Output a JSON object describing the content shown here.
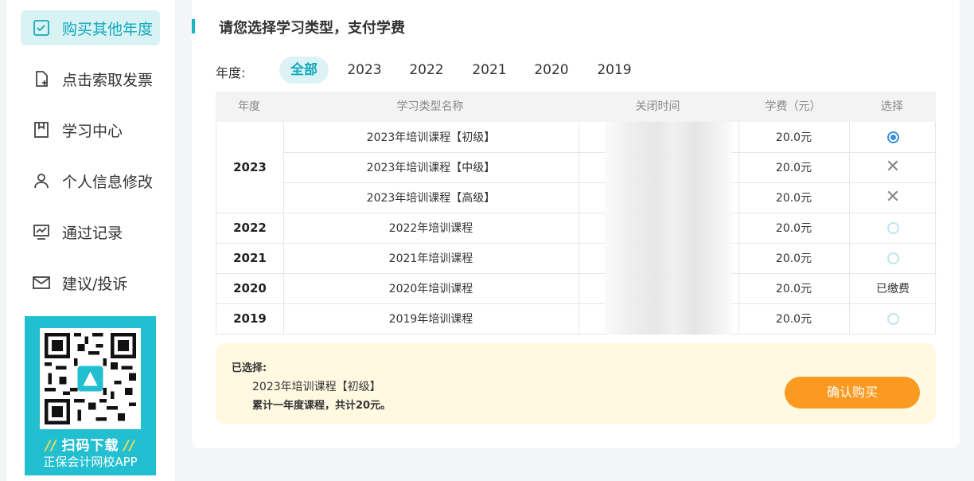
{
  "sidebar": {
    "items": [
      {
        "label": "购买其他年度",
        "icon": "check-square-icon",
        "active": true
      },
      {
        "label": "点击索取发票",
        "icon": "document-add-icon",
        "active": false
      },
      {
        "label": "学习中心",
        "icon": "bookmark-icon",
        "active": false
      },
      {
        "label": "个人信息修改",
        "icon": "user-icon",
        "active": false
      },
      {
        "label": "通过记录",
        "icon": "chart-monitor-icon",
        "active": false
      },
      {
        "label": "建议/投诉",
        "icon": "mail-icon",
        "active": false
      }
    ],
    "qr": {
      "cta": "扫码下载",
      "slash": "//",
      "app_name": "正保会计网校APP"
    }
  },
  "main": {
    "title": "请您选择学习类型，支付学费",
    "year_filter": {
      "label": "年度:",
      "tabs": [
        "全部",
        "2023",
        "2022",
        "2021",
        "2020",
        "2019"
      ],
      "active": "全部"
    },
    "table": {
      "headers": [
        "年度",
        "学习类型名称",
        "关闭时间",
        "学费（元）",
        "选择"
      ],
      "rows": [
        {
          "year": "2023",
          "name": "2023年培训课程【初级】",
          "fee": "20.0元",
          "select": "checked"
        },
        {
          "year": "",
          "name": "2023年培训课程【中级】",
          "fee": "20.0元",
          "select": "unavailable"
        },
        {
          "year": "",
          "name": "2023年培训课程【高级】",
          "fee": "20.0元",
          "select": "unavailable"
        },
        {
          "year": "2022",
          "name": "2022年培训课程",
          "fee": "20.0元",
          "select": "unchecked"
        },
        {
          "year": "2021",
          "name": "2021年培训课程",
          "fee": "20.0元",
          "select": "unchecked"
        },
        {
          "year": "2020",
          "name": "2020年培训课程",
          "fee": "20.0元",
          "select": "已缴费"
        },
        {
          "year": "2019",
          "name": "2019年培训课程",
          "fee": "20.0元",
          "select": "unchecked"
        }
      ]
    },
    "summary": {
      "label": "已选择:",
      "course": "2023年培训课程【初级】",
      "total": "累计一年度课程，共计20元。",
      "confirm_label": "确认购买"
    }
  },
  "colors": {
    "accent": "#18b5c6",
    "active_bg": "#d9f3f5",
    "confirm": "#fb9a21",
    "radio": "#3a8fd8",
    "summary_bg": "#fff9e1"
  }
}
